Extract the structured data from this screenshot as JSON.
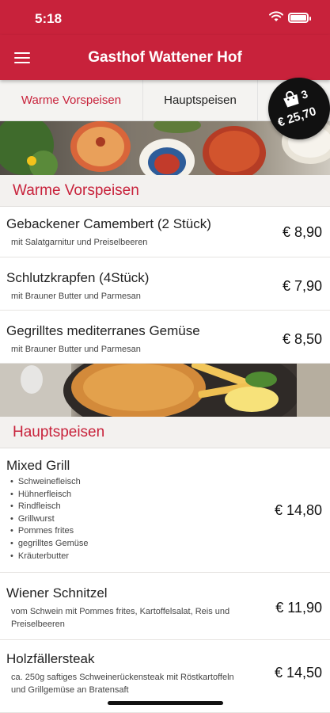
{
  "status": {
    "time": "5:18"
  },
  "header": {
    "title": "Gasthof Wattener Hof"
  },
  "tabs": [
    {
      "label": "Warme Vorspeisen",
      "active": true
    },
    {
      "label": "Hauptspeisen",
      "active": false
    },
    {
      "label": "",
      "active": false
    }
  ],
  "cart": {
    "count": "3",
    "total": "€ 25,70"
  },
  "sections": [
    {
      "title": "Warme Vorspeisen",
      "items": [
        {
          "name": "Gebackener Camembert (2 Stück)",
          "desc": "mit Salatgarnitur und Preiselbeeren",
          "price": "€ 8,90"
        },
        {
          "name": "Schlutzkrapfen (4Stück)",
          "desc": "mit Brauner Butter und Parmesan",
          "price": "€ 7,90"
        },
        {
          "name": "Gegrilltes mediterranes Gemüse",
          "desc": "mit Brauner Butter und Parmesan",
          "price": "€ 8,50"
        }
      ]
    },
    {
      "title": "Hauptspeisen",
      "items": [
        {
          "name": "Mixed Grill",
          "bullets": [
            "Schweinefleisch",
            "Hühnerfleisch",
            "Rindfleisch",
            "Grillwurst",
            "Pommes frites",
            "gegrilltes Gemüse",
            "Kräuterbutter"
          ],
          "price": "€ 14,80"
        },
        {
          "name": "Wiener Schnitzel",
          "desc": "vom Schwein mit Pommes frites, Kartoffelsalat, Reis und Preiselbeeren",
          "price": "€ 11,90"
        },
        {
          "name": "Holzfällersteak",
          "desc": "ca. 250g saftiges Schweinerückensteak mit Röstkartoffeln und Grillgemüse an Bratensaft",
          "price": "€ 14,50"
        }
      ]
    }
  ],
  "colors": {
    "accent": "#c8223b",
    "section_bg": "#f3f1ef",
    "badge": "#111111"
  }
}
